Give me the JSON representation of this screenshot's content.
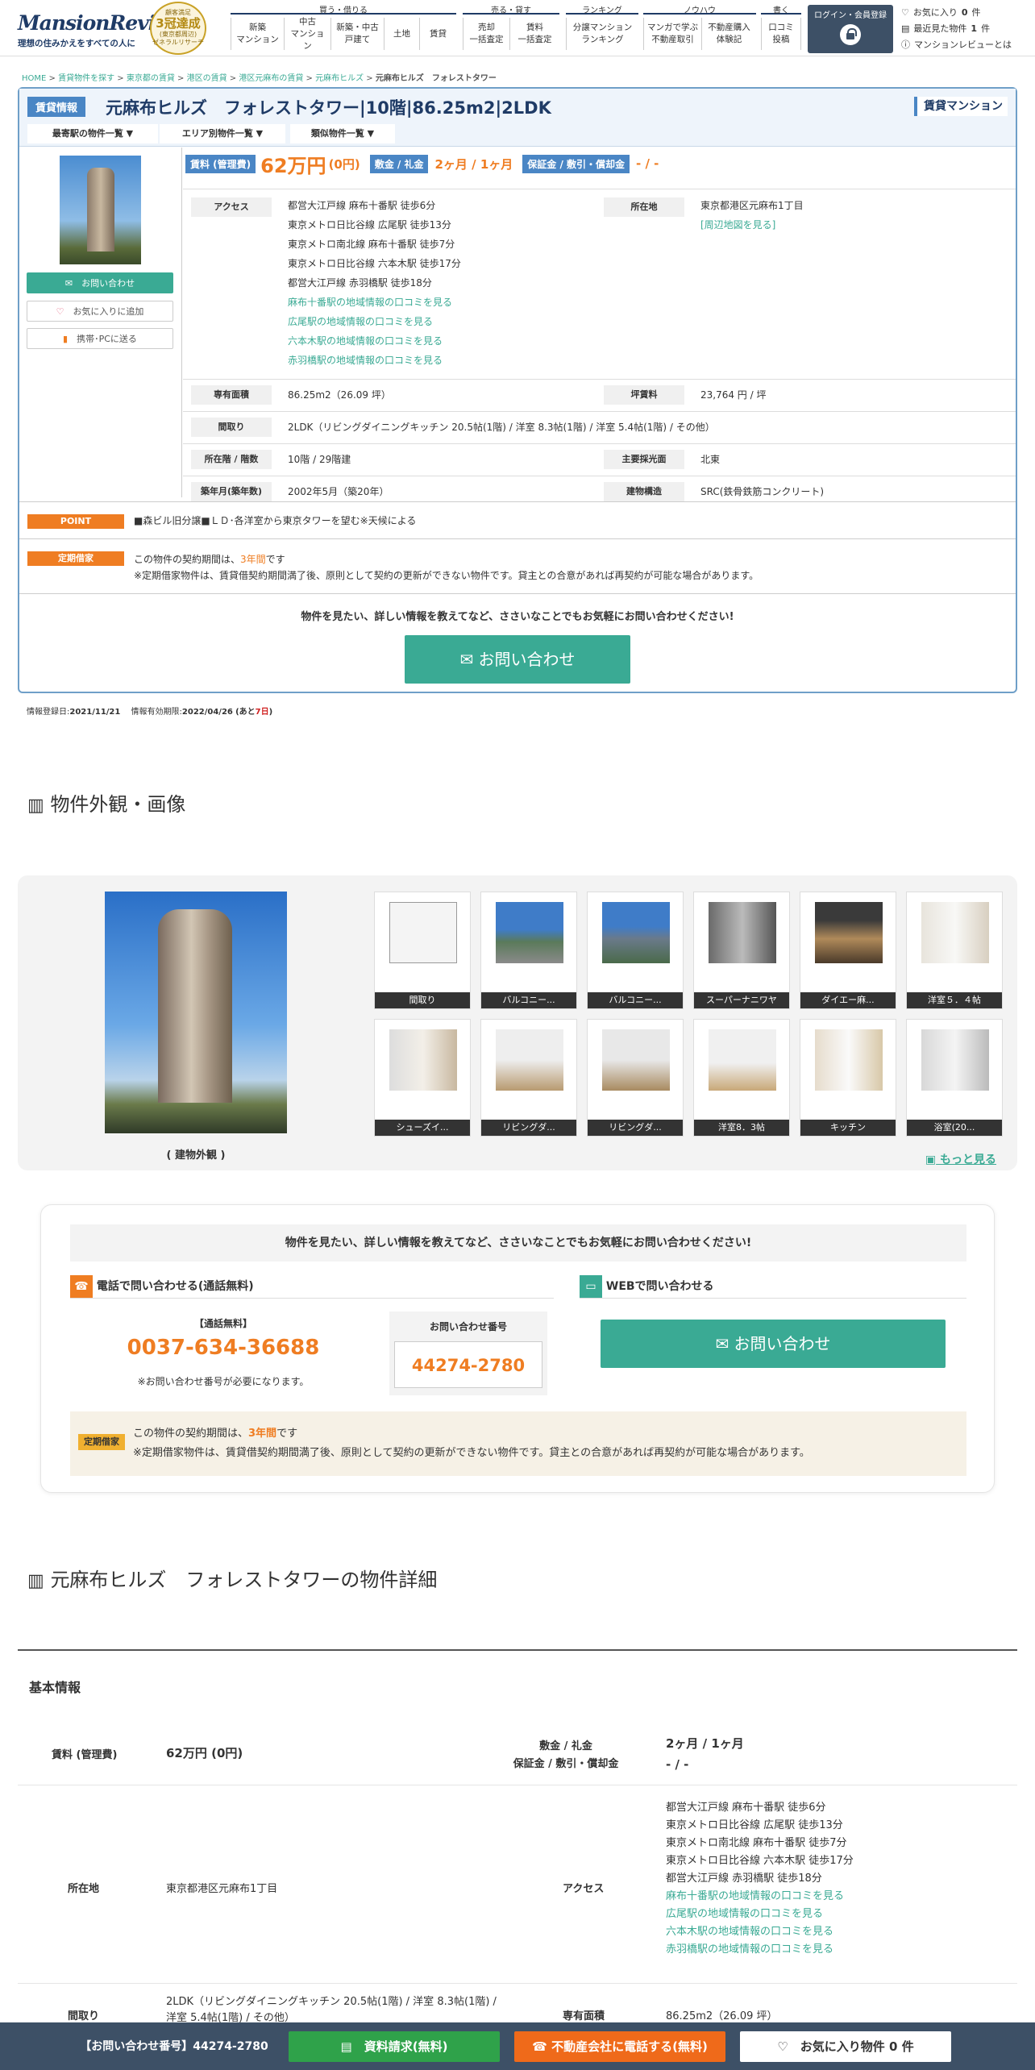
{
  "header": {
    "logo": "MansionReview",
    "tagline": "理想の住みかえをすべての人に",
    "award": {
      "l1": "顧客満足",
      "big": "3冠達成",
      "l2": "(東京都周辺)",
      "l3": "ゼネラルリサーチ"
    },
    "nav": [
      {
        "group": "買う・借りる",
        "items": [
          "新築\nマンション",
          "中古\nマンション",
          "新築・中古\n戸建て",
          "土地",
          "賃貸"
        ]
      },
      {
        "group": "売る・貸す",
        "items": [
          "売却\n一括査定",
          "賃料\n一括査定"
        ]
      },
      {
        "group": "ランキング",
        "items": [
          "分譲マンション\nランキング"
        ]
      },
      {
        "group": "ノウハウ",
        "items": [
          "マンガで学ぶ\n不動産取引",
          "不動産購入\n体験記"
        ]
      },
      {
        "group": "書く",
        "items": [
          "口コミ\n投稿"
        ]
      }
    ],
    "login": "ログイン・会員登録",
    "links": [
      {
        "icon": "heart-icon",
        "pre": "お気に入り",
        "num": "0",
        "post": "件"
      },
      {
        "icon": "document-icon",
        "pre": "最近見た物件",
        "num": "1",
        "post": "件"
      },
      {
        "icon": "question-icon",
        "pre": "マンションレビューとは",
        "num": "",
        "post": ""
      }
    ]
  },
  "breadcrumb": [
    "HOME",
    "賃貸物件を探す",
    "東京都の賃貸",
    "港区の賃貸",
    "港区元麻布の賃貸",
    "元麻布ヒルズ",
    "元麻布ヒルズ　フォレストタワー"
  ],
  "property": {
    "tag": "賃貸情報",
    "title": "元麻布ヒルズ　フォレストタワー|10階|86.25m2|2LDK",
    "type_tag": "賃貸マンション",
    "dropdowns": [
      "最寄駅の物件一覧 ▼",
      "エリア別物件一覧 ▼",
      "類似物件一覧 ▼"
    ],
    "buttons": {
      "inquiry": "お問い合わせ",
      "favorite": "お気に入りに追加",
      "mobile": "携帯･PCに送る"
    },
    "price_label": "賃料 (管理費)",
    "price": "62万円",
    "price_sub": "(0円)",
    "deposit_label": "敷金 / 礼金",
    "deposit": "2ヶ月 / 1ヶ月",
    "guarantee_label": "保証金 / 敷引・償却金",
    "guarantee": "- / -",
    "access_label": "アクセス",
    "access": [
      "都営大江戸線 麻布十番駅 徒歩6分",
      "東京メトロ日比谷線 広尾駅 徒歩13分",
      "東京メトロ南北線 麻布十番駅 徒歩7分",
      "東京メトロ日比谷線 六本木駅 徒歩17分",
      "都営大江戸線 赤羽橋駅 徒歩18分"
    ],
    "access_links": [
      "麻布十番駅の地域情報の口コミを見る",
      "広尾駅の地域情報の口コミを見る",
      "六本木駅の地域情報の口コミを見る",
      "赤羽橋駅の地域情報の口コミを見る"
    ],
    "address_label": "所在地",
    "address": "東京都港区元麻布1丁目",
    "map_link": "[周辺地図を見る]",
    "area_label": "専有面積",
    "area": "86.25m2（26.09 坪）",
    "unit_price_label": "坪賃料",
    "unit_price": "23,764 円 / 坪",
    "layout_label": "間取り",
    "layout": "2LDK（リビングダイニングキッチン 20.5帖(1階) / 洋室 8.3帖(1階) / 洋室 5.4帖(1階) / その他）",
    "floor_label": "所在階 / 階数",
    "floor": "10階 / 29階建",
    "light_label": "主要採光面",
    "light": "北東",
    "built_label": "築年月(築年数)",
    "built": "2002年5月（築20年）",
    "structure_label": "建物構造",
    "structure": "SRC(鉄骨鉄筋コンクリート)",
    "point_label": "POINT",
    "point": "■森ビル旧分譲■ＬＤ･各洋室から東京タワーを望む※天候による",
    "lease_label": "定期借家",
    "lease_pre": "この物件の契約期間は、",
    "lease_term": "3年間",
    "lease_post": "です",
    "lease_note": "※定期借家物件は、賃貸借契約期間満了後、原則として契約の更新ができない物件です。貸主との合意があれば再契約が可能な場合があります。",
    "cta_text": "物件を見たい、詳しい情報を教えてなど、ささいなことでもお気軽にお問い合わせください!",
    "cta_button": "お問い合わせ"
  },
  "info": {
    "reg_label": "情報登録日:",
    "reg": "2021/11/21",
    "valid_label": "情報有効期限:",
    "valid": "2022/04/26",
    "rem_pre": "(あと",
    "rem": "7日",
    "rem_post": ")"
  },
  "gallery": {
    "heading": "物件外観・画像",
    "main_caption": "( 建物外観 )",
    "thumbs": [
      "間取り",
      "バルコニー...",
      "バルコニー...",
      "スーパーナニワヤ",
      "ダイエー麻...",
      "洋室５．４帖",
      "シューズイ...",
      "リビングダ...",
      "リビングダ...",
      "洋室8．3帖",
      "キッチン",
      "浴室(20..."
    ],
    "more": "もっと見る"
  },
  "contact": {
    "banner": "物件を見たい、詳しい情報を教えてなど、ささいなことでもお気軽にお問い合わせください!",
    "phone_head": "電話で問い合わせる(通話無料)",
    "free_label": "【通話無料】",
    "phone": "0037-634-36688",
    "phone_note": "※お問い合わせ番号が必要になります。",
    "num_label": "お問い合わせ番号",
    "num": "44274-2780",
    "web_head": "WEBで問い合わせる",
    "web_button": "お問い合わせ",
    "lease_label": "定期借家"
  },
  "detail": {
    "heading": "元麻布ヒルズ　フォレストタワーの物件詳細",
    "sub": "基本情報"
  },
  "bottom": {
    "num_label": "【お問い合わせ番号】44274-2780",
    "docs": "資料請求(無料)",
    "call": "不動産会社に電話する(無料)",
    "fav_pre": "お気に入り物件",
    "fav_num": "0",
    "fav_post": "件"
  },
  "colors": {
    "navy": "#1f3b66",
    "blue": "#4a86c5",
    "teal": "#3aaa94",
    "orange": "#ef7d22",
    "bar": "#3d5066"
  }
}
